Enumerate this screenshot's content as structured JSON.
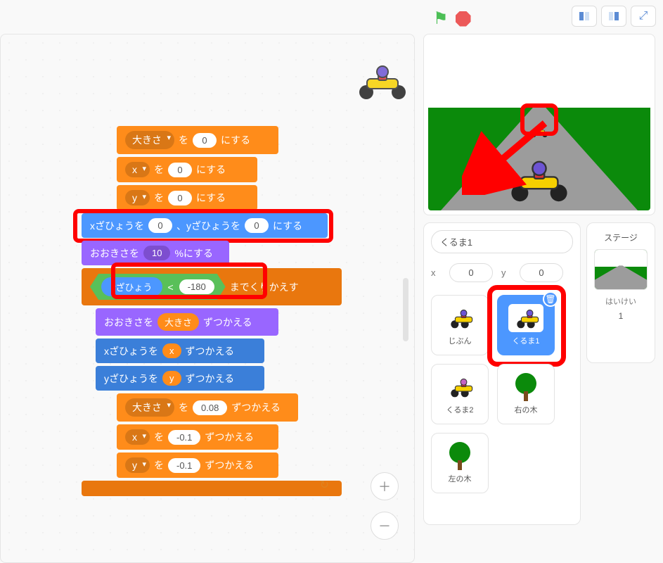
{
  "controls": {},
  "blocks": {
    "setSize": {
      "dropdown": "大きさ",
      "mid": "を",
      "val": "0",
      "after": "にする"
    },
    "setX": {
      "dropdown": "x",
      "mid": "を",
      "val": "0",
      "after": "にする"
    },
    "setY": {
      "dropdown": "y",
      "mid": "を",
      "val": "0",
      "after": "にする"
    },
    "goto": {
      "pre": "xざひょうを",
      "x": "0",
      "mid": "、yざひょうを",
      "y": "0",
      "after": "にする"
    },
    "sizePct": {
      "pre": "おおきさを",
      "val": "10",
      "after": "%にする"
    },
    "repeatUntil": {
      "reporter": "yざひょう",
      "op": "<",
      "val": "-180",
      "after": "までくりかえす"
    },
    "changeLookSize": {
      "pre": "おおきさを",
      "reporter": "大きさ",
      "after": "ずつかえる"
    },
    "changeXby": {
      "pre": "xざひょうを",
      "reporter": "x",
      "after": "ずつかえる"
    },
    "changeYby": {
      "pre": "yざひょうを",
      "reporter": "y",
      "after": "ずつかえる"
    },
    "incSize": {
      "dropdown": "大きさ",
      "mid": "を",
      "val": "0.08",
      "after": "ずつかえる"
    },
    "incX": {
      "dropdown": "x",
      "mid": "を",
      "val": "-0.1",
      "after": "ずつかえる"
    },
    "incY": {
      "dropdown": "y",
      "mid": "を",
      "val": "-0.1",
      "after": "ずつかえる"
    }
  },
  "spritePanel": {
    "name": "くるま1",
    "xLabel": "x",
    "xVal": "0",
    "yLabel": "y",
    "yVal": "0",
    "cards": {
      "jibun": "じぶん",
      "kuruma1": "くるま1",
      "kuruma2": "くるま2",
      "migi": "右の木",
      "hidari": "左の木"
    }
  },
  "stagePanel": {
    "title": "ステージ",
    "sublabel": "はいけい",
    "count": "1"
  }
}
